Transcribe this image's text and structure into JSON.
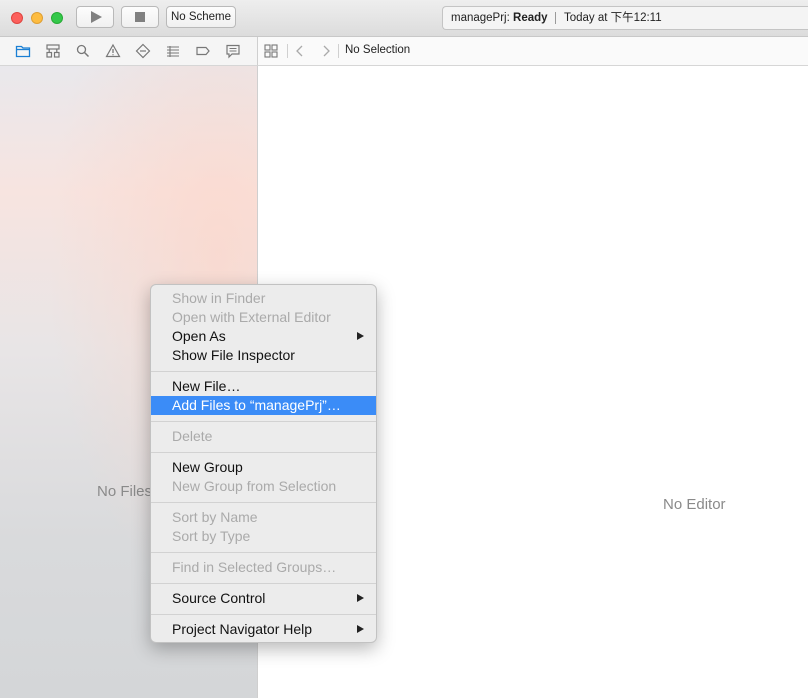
{
  "toolbar": {
    "scheme_label": "No Scheme",
    "activity": {
      "project_prefix": "managePrj: ",
      "status": "Ready",
      "time": "Today at 下午12:11"
    }
  },
  "navigator": {
    "icons": [
      "folder-icon",
      "hierarchy-icon",
      "search-icon",
      "warning-icon",
      "test-diamond-icon",
      "debug-list-icon",
      "breakpoint-icon",
      "report-icon"
    ],
    "empty_text": "No Files"
  },
  "jumpbar": {
    "text": "No Selection"
  },
  "editor": {
    "empty_text": "No Editor"
  },
  "context_menu": {
    "groups": [
      [
        {
          "label": "Show in Finder",
          "enabled": false
        },
        {
          "label": "Open with External Editor",
          "enabled": false
        },
        {
          "label": "Open As",
          "enabled": true,
          "submenu": true
        },
        {
          "label": "Show File Inspector",
          "enabled": true
        }
      ],
      [
        {
          "label": "New File…",
          "enabled": true
        },
        {
          "label": "Add Files to “managePrj”…",
          "enabled": true,
          "highlighted": true
        }
      ],
      [
        {
          "label": "Delete",
          "enabled": false
        }
      ],
      [
        {
          "label": "New Group",
          "enabled": true
        },
        {
          "label": "New Group from Selection",
          "enabled": false
        }
      ],
      [
        {
          "label": "Sort by Name",
          "enabled": false
        },
        {
          "label": "Sort by Type",
          "enabled": false
        }
      ],
      [
        {
          "label": "Find in Selected Groups…",
          "enabled": false
        }
      ],
      [
        {
          "label": "Source Control",
          "enabled": true,
          "submenu": true
        }
      ],
      [
        {
          "label": "Project Navigator Help",
          "enabled": true,
          "submenu": true
        }
      ]
    ]
  },
  "colors": {
    "highlight": "#3b8cf7",
    "selected_icon": "#1a7fd4",
    "disabled_text": "#aaaaaa"
  }
}
